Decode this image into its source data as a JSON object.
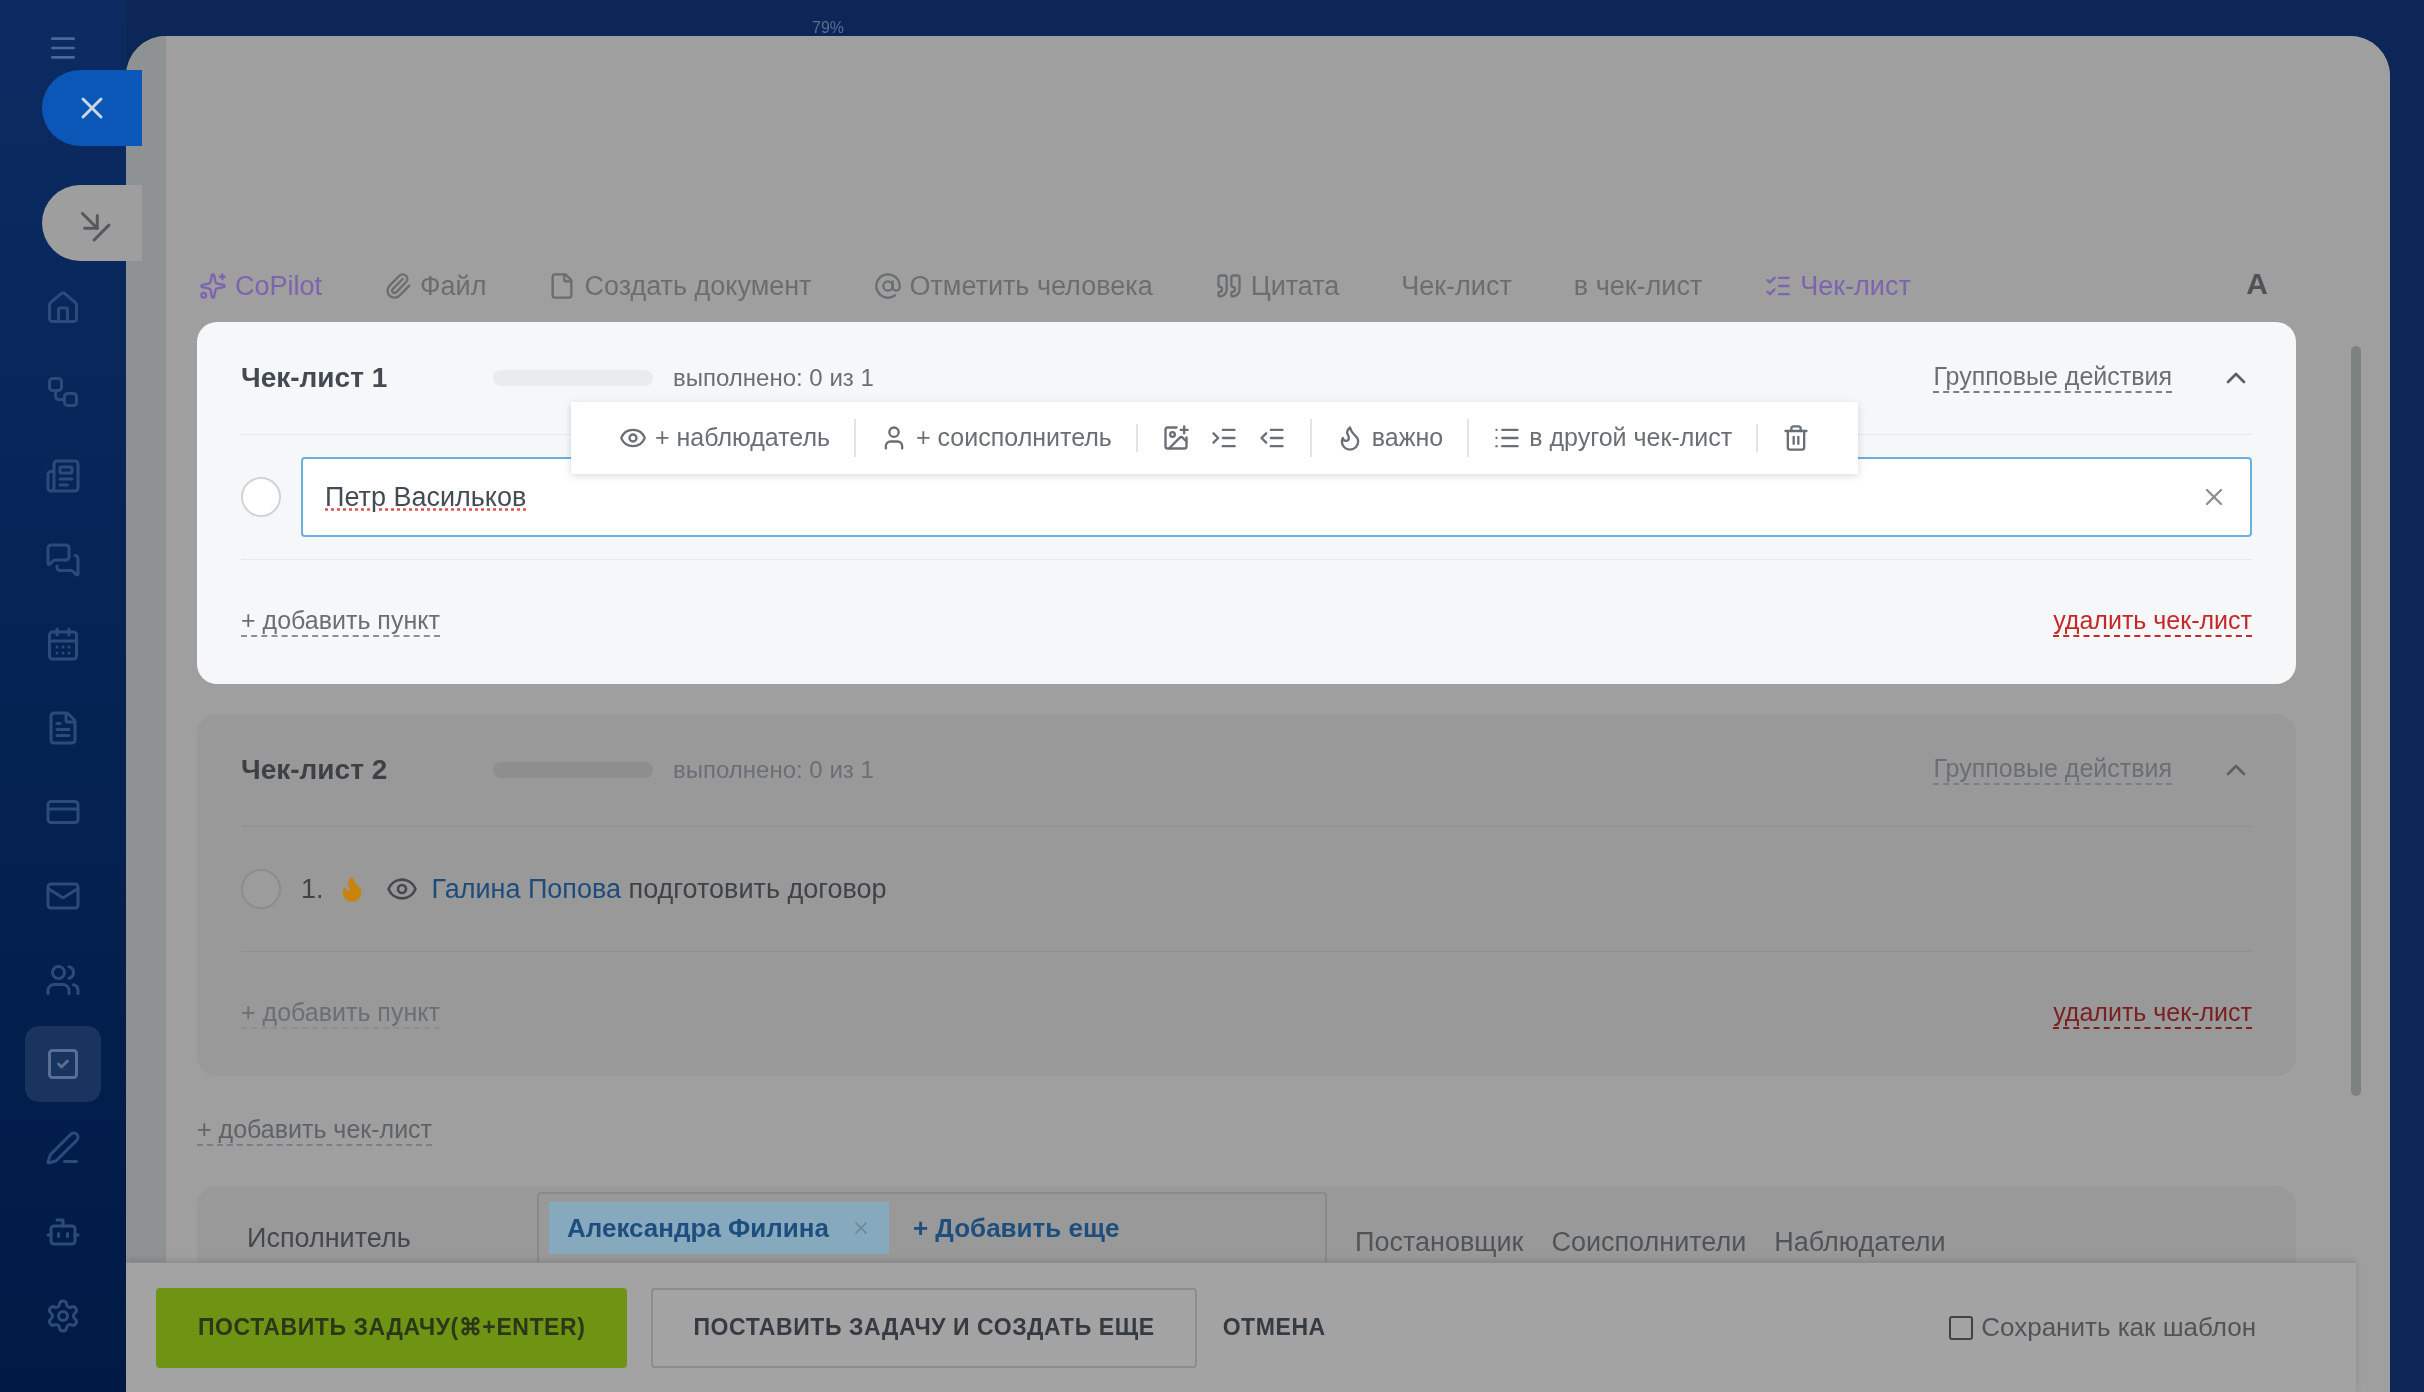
{
  "zoom_label": "79%",
  "sidebar": {
    "items": [
      {
        "selected": false
      },
      {
        "selected": false
      },
      {
        "selected": false
      },
      {
        "selected": false
      },
      {
        "selected": false
      },
      {
        "selected": false
      },
      {
        "selected": false
      },
      {
        "selected": false
      },
      {
        "selected": false
      },
      {
        "selected": true
      },
      {
        "selected": false
      },
      {
        "selected": false
      },
      {
        "selected": false
      }
    ]
  },
  "editor_toolbar": [
    {
      "kind": "copilot",
      "label": "CoPilot"
    },
    {
      "kind": "file",
      "label": "Файл"
    },
    {
      "kind": "document",
      "label": "Создать документ"
    },
    {
      "kind": "mention",
      "label": "Отметить человека"
    },
    {
      "kind": "quote",
      "label": "Цитата"
    },
    {
      "kind": "plain",
      "label": "Чек-лист"
    },
    {
      "kind": "plain",
      "label": "в чек-лист"
    },
    {
      "kind": "checklist",
      "label": "Чек-лист"
    }
  ],
  "format_button": "A",
  "checklists": [
    {
      "title": "Чек-лист 1",
      "focused": true,
      "progress": {
        "level": 0,
        "reading": "выполнено: 0 из 1"
      },
      "group_actions": "Групповые действия",
      "expanded": true,
      "item_toolbar": [
        {
          "buttons": [
            {
              "kind": "watcher",
              "label": "+ наблюдатель"
            }
          ]
        },
        {
          "buttons": [
            {
              "kind": "coexecutor",
              "label": "+ соисполнитель"
            }
          ]
        },
        {
          "buttons": [
            {
              "kind": "attach"
            },
            {
              "kind": "indent"
            },
            {
              "kind": "outdent"
            }
          ]
        },
        {
          "buttons": [
            {
              "kind": "important",
              "label": "важно"
            }
          ]
        },
        {
          "buttons": [
            {
              "kind": "move",
              "label": "в другой чек-лист"
            }
          ]
        },
        {
          "buttons": [
            {
              "kind": "delete"
            }
          ]
        }
      ],
      "items": [
        {
          "kind": "editing",
          "checked": false,
          "value": "Петр Васильков"
        }
      ],
      "add_item": "+ добавить пункт",
      "delete": "удалить чек-лист"
    },
    {
      "title": "Чек-лист 2",
      "focused": false,
      "progress": {
        "level": 0,
        "reading": "выполнено: 0 из 1"
      },
      "group_actions": "Групповые действия",
      "expanded": true,
      "items": [
        {
          "kind": "text",
          "checked": false,
          "number": "1.",
          "important": true,
          "watcher": "Галина Попова",
          "text": "подготовить договор"
        }
      ],
      "add_item": "+ добавить пункт",
      "delete": "удалить чек-лист"
    }
  ],
  "add_checklist": "+ добавить чек-лист",
  "assignee": {
    "label": "Исполнитель",
    "chips": [
      "Александра Филина"
    ],
    "add_more": "+ Добавить еще",
    "links": [
      "Постановщик",
      "Соисполнители",
      "Наблюдатели"
    ]
  },
  "footer": {
    "primary": "ПОСТАВИТЬ ЗАДАЧУ(⌘+ENTER)",
    "secondary": "ПОСТАВИТЬ ЗАДАЧУ И СОЗДАТЬ ЕЩЕ",
    "cancel": "ОТМЕНА",
    "save_template": {
      "label": "Сохранить как шаблон",
      "checked": false
    }
  }
}
